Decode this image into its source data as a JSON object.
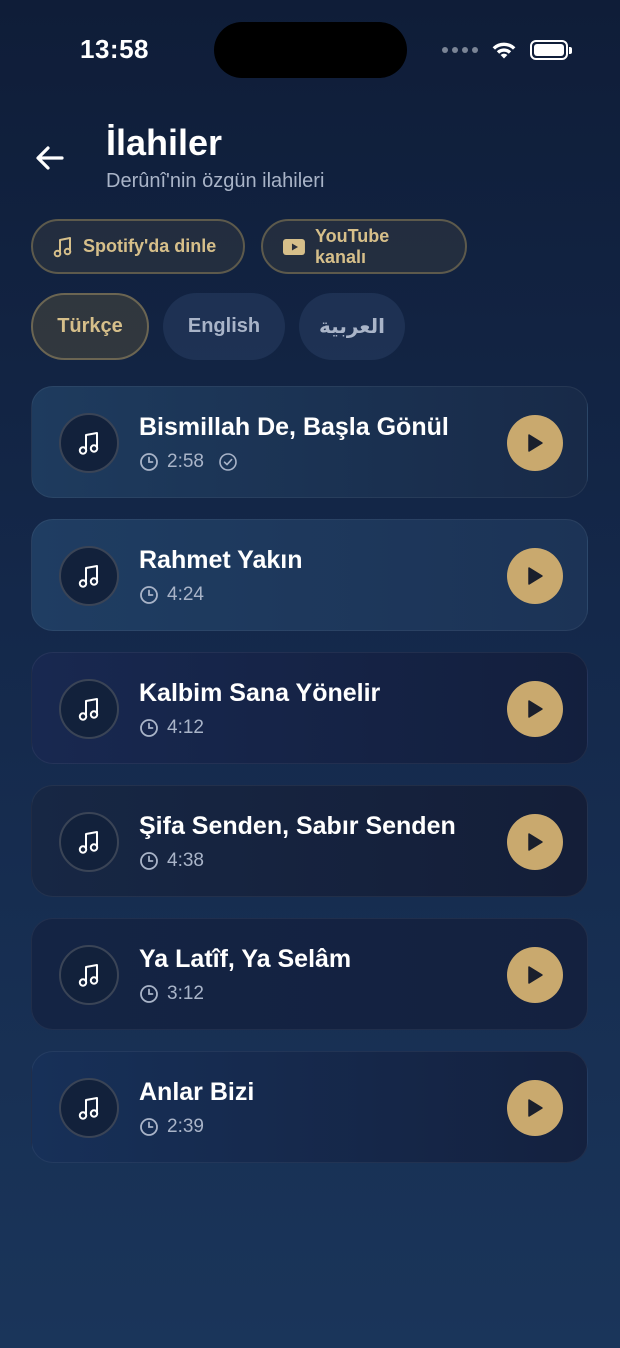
{
  "status": {
    "time": "13:58"
  },
  "header": {
    "title": "İlahiler",
    "subtitle": "Derûnî'nin özgün ilahileri"
  },
  "links": {
    "spotify_label": "Spotify'da dinle",
    "youtube_label": "YouTube kanalı"
  },
  "languages": [
    {
      "label": "Türkçe",
      "active": true
    },
    {
      "label": "English",
      "active": false
    },
    {
      "label": "العربية",
      "active": false
    }
  ],
  "tracks": [
    {
      "title": "Bismillah De, Başla Gönül",
      "duration": "2:58",
      "completed": true
    },
    {
      "title": "Rahmet Yakın",
      "duration": "4:24",
      "completed": false
    },
    {
      "title": "Kalbim Sana Yönelir",
      "duration": "4:12",
      "completed": false
    },
    {
      "title": "Şifa Senden, Sabır Senden",
      "duration": "4:38",
      "completed": false
    },
    {
      "title": "Ya Latîf, Ya Selâm",
      "duration": "3:12",
      "completed": false
    },
    {
      "title": "Anlar Bizi",
      "duration": "2:39",
      "completed": false
    }
  ],
  "colors": {
    "accent_gold": "#c9a96e",
    "gold_text": "#d6bf8a",
    "muted_text": "#a9b4c8",
    "background": "#14284a"
  },
  "icons": {
    "back": "arrow-left-icon",
    "spotify": "music-note-icon",
    "youtube": "youtube-icon",
    "track": "music-note-icon",
    "duration": "clock-icon",
    "completed": "check-circle-icon",
    "play": "play-icon"
  }
}
